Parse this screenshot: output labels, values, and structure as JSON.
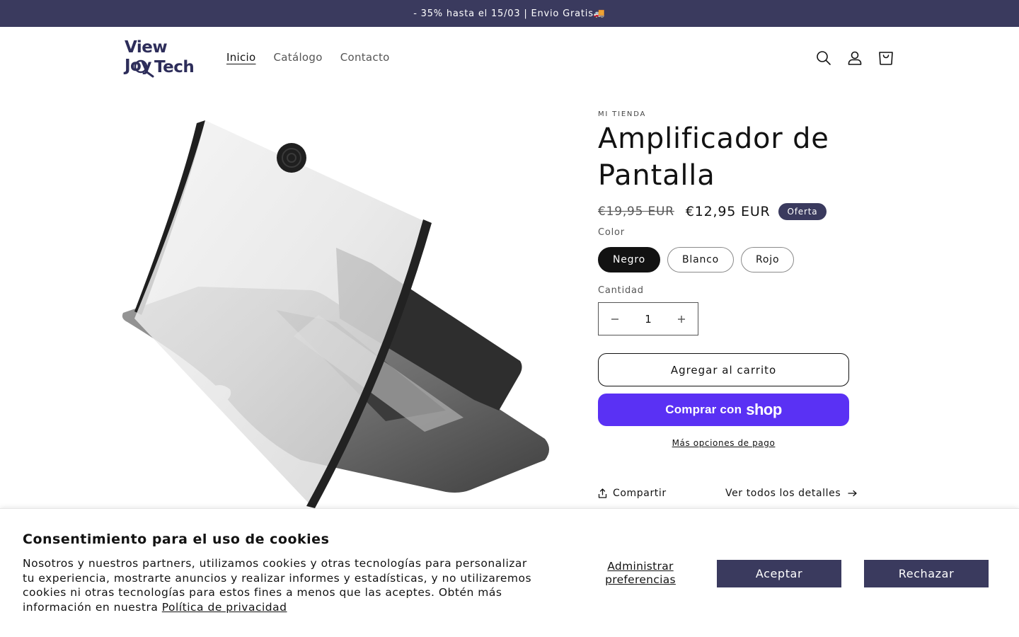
{
  "announcement": {
    "text": "- 35% hasta el 15/03 | Envio Gratis🚚"
  },
  "header": {
    "logo": {
      "line1": "View Joy",
      "line2": "Tech"
    },
    "nav": [
      {
        "label": "Inicio",
        "active": true
      },
      {
        "label": "Catálogo",
        "active": false
      },
      {
        "label": "Contacto",
        "active": false
      }
    ],
    "icons": [
      "search-icon",
      "account-icon",
      "cart-icon"
    ]
  },
  "product": {
    "vendor": "MI TIENDA",
    "title": "Amplificador de Pantalla",
    "price_old": "€19,95 EUR",
    "price_new": "€12,95 EUR",
    "badge": "Oferta",
    "color_label": "Color",
    "colors": [
      {
        "label": "Negro",
        "selected": true
      },
      {
        "label": "Blanco",
        "selected": false
      },
      {
        "label": "Rojo",
        "selected": false
      }
    ],
    "quantity_label": "Cantidad",
    "quantity_value": "1",
    "add_to_cart": "Agregar al carrito",
    "shop_pay_text": "Comprar con",
    "shop_pay_brand": "shop",
    "more_payment": "Más opciones de pago",
    "share": "Compartir",
    "view_details": "Ver todos los detalles"
  },
  "cookie": {
    "title": "Consentimiento para el uso de cookies",
    "text": "Nosotros y nuestros partners, utilizamos cookies y otras tecnologías para personalizar tu experiencia, mostrarte anuncios y realizar informes y estadísticas, y no utilizaremos cookies ni otras tecnologías para estos fines a menos que las aceptes. Obtén más información en nuestra ",
    "link": "Política de privacidad",
    "manage": "Administrar preferencias",
    "accept": "Aceptar",
    "reject": "Rechazar"
  },
  "colors": {
    "accent": "#3a3a5e",
    "shop_pay": "#5a31f4",
    "text": "#121212"
  }
}
